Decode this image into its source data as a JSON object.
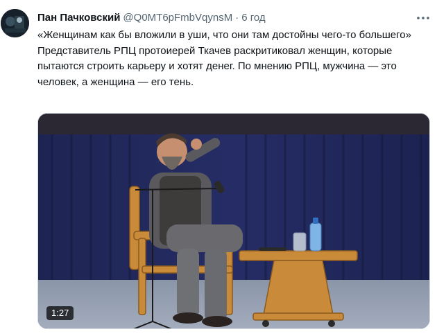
{
  "author": {
    "name": "Пан Пачковский",
    "handle": "@Q0MT6pFmbVqynsM",
    "separator": "·",
    "time": "6 год"
  },
  "tweet": {
    "lines": [
      "«Женщинам как бы вложили в уши, что они там достойны чего-то большего»",
      "Представитель РПЦ протоиерей Ткачев раскритиковал женщин, которые пытаются строить карьеру и хотят денег. По  мнению РПЦ, мужчина — это человек, а женщина — его тень."
    ]
  },
  "media": {
    "duration": "1:27"
  },
  "icons": {
    "more": "more-options-icon",
    "avatar": "avatar-image"
  }
}
